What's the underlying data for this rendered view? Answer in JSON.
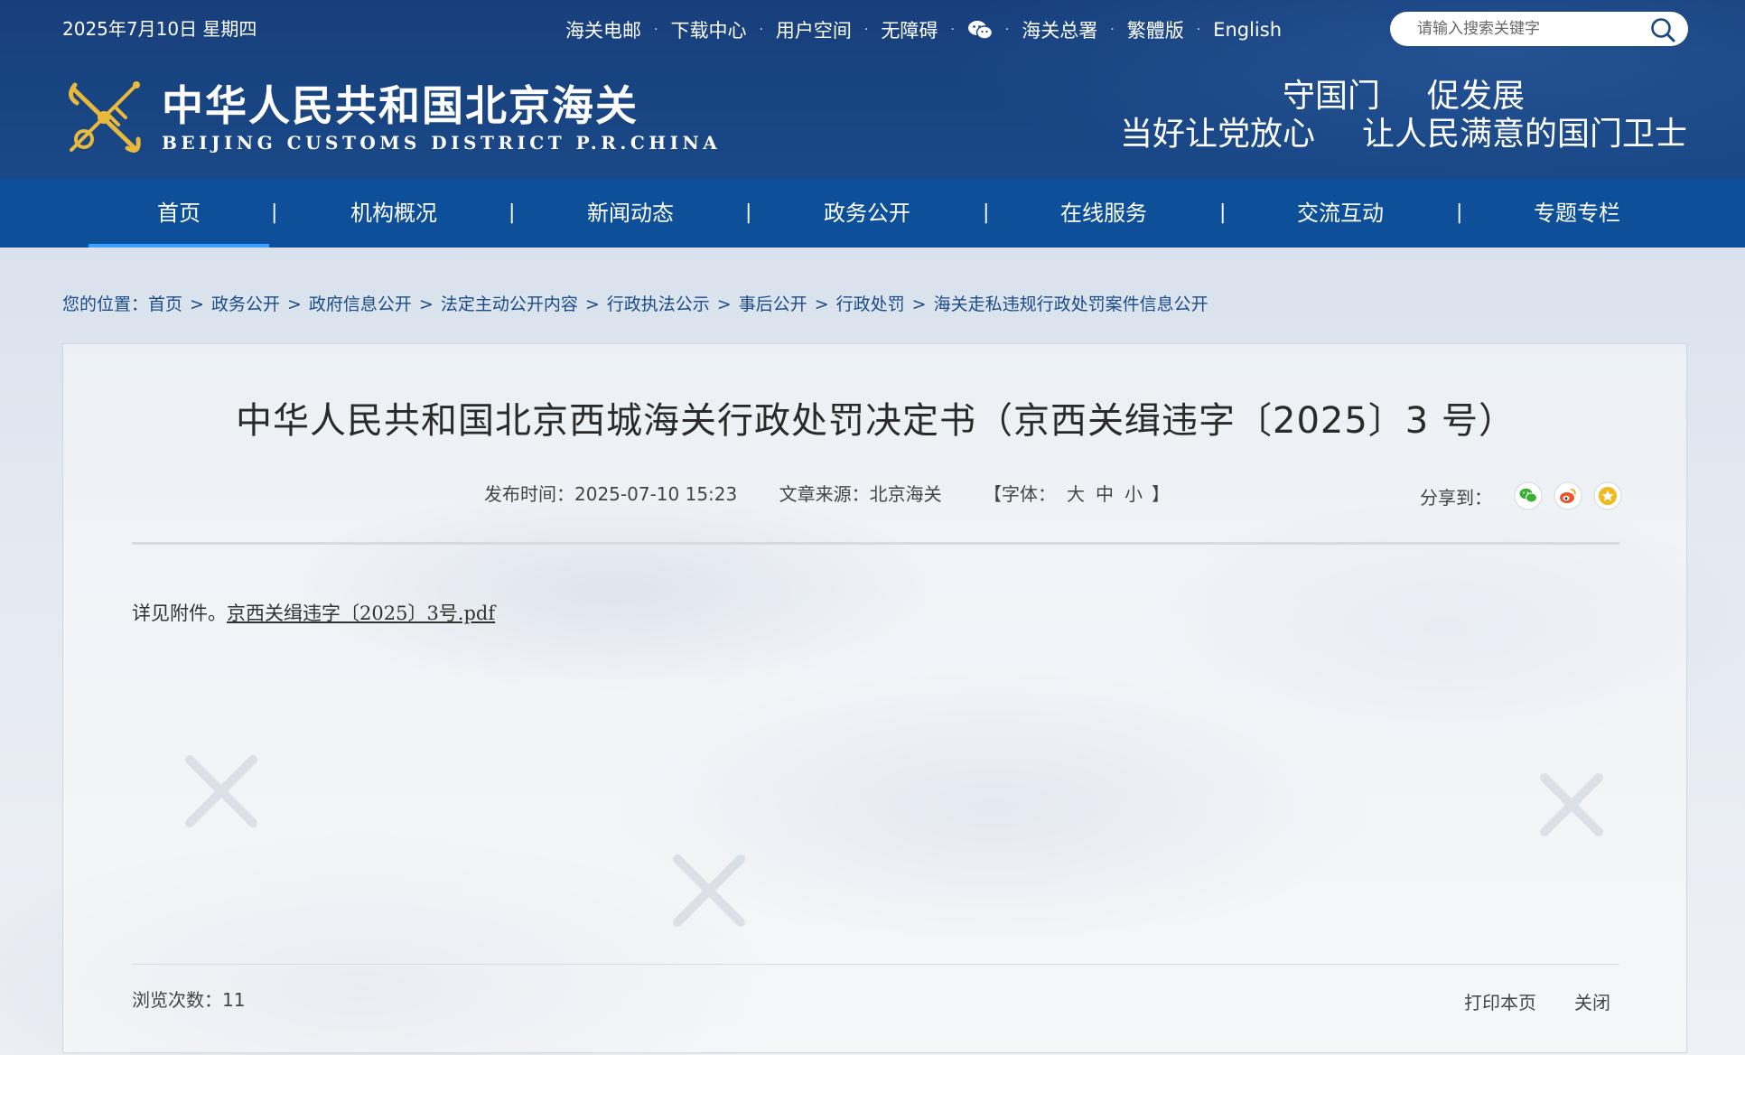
{
  "header": {
    "date": "2025年7月10日 星期四",
    "top_links": [
      "海关电邮",
      "下载中心",
      "用户空间",
      "无障碍"
    ],
    "top_links_after": [
      "海关总署",
      "繁體版",
      "English"
    ],
    "search_placeholder": "请输入搜索关键字",
    "logo_cn": "中华人民共和国北京海关",
    "logo_en": "BEIJING CUSTOMS DISTRICT P.R.CHINA",
    "slogan_line1": [
      "守国门",
      "促发展"
    ],
    "slogan_line2": [
      "当好让党放心",
      "让人民满意的国门卫士"
    ]
  },
  "nav": {
    "items": [
      "首页",
      "机构概况",
      "新闻动态",
      "政务公开",
      "在线服务",
      "交流互动",
      "专题专栏"
    ],
    "active": "首页",
    "separator": "|"
  },
  "breadcrumb": {
    "label": "您的位置：",
    "items": [
      "首页",
      "政务公开",
      "政府信息公开",
      "法定主动公开内容",
      "行政执法公示",
      "事后公开",
      "行政处罚",
      "海关走私违规行政处罚案件信息公开"
    ],
    "separator": ">"
  },
  "article": {
    "title": "中华人民共和国北京西城海关行政处罚决定书（京西关缉违字〔2025〕3 号）",
    "publish_label": "发布时间：",
    "publish_time": "2025-07-10 15:23",
    "source_label": "文章来源：",
    "source": "北京海关",
    "font_label_open": "【字体：",
    "font_sizes": [
      "大",
      "中",
      "小"
    ],
    "font_label_close": "】",
    "share_label": "分享到：",
    "body_prefix": "详见附件。",
    "attachment": "京西关缉违字〔2025〕3号.pdf",
    "views_label": "浏览次数：",
    "views": "11",
    "print": "打印本页",
    "close": "关闭"
  },
  "colors": {
    "header_bg": "#173f7c",
    "nav_bg": "#0d5099",
    "breadcrumb": "#1a4a8a",
    "wechat": "#3cb034",
    "weibo": "#e8552c",
    "favorite": "#f2b81c"
  },
  "icons": [
    "wechat-icon",
    "search-icon",
    "customs-emblem",
    "wechat-share-icon",
    "weibo-share-icon",
    "favorite-share-icon"
  ]
}
